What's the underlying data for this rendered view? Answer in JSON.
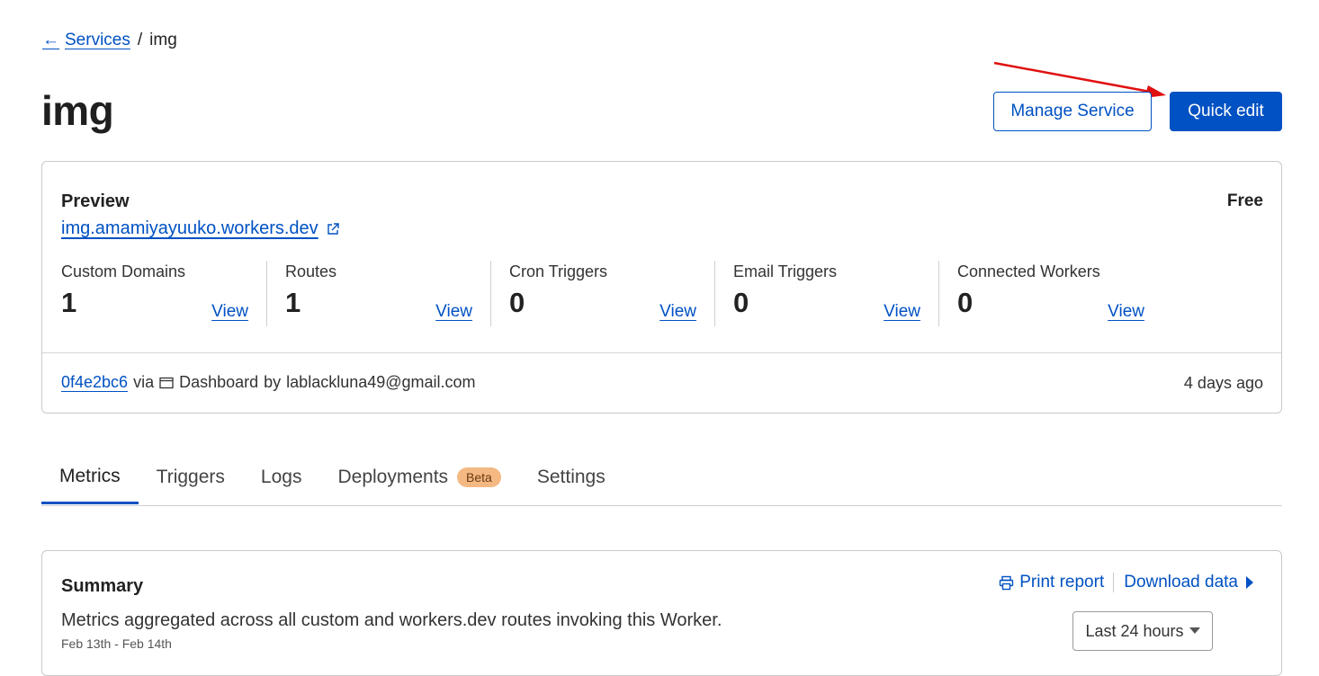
{
  "breadcrumb": {
    "back_label": "Services",
    "separator": "/",
    "current": "img"
  },
  "page": {
    "title": "img"
  },
  "actions": {
    "manage_label": "Manage Service",
    "quick_edit_label": "Quick edit"
  },
  "preview": {
    "label": "Preview",
    "plan": "Free",
    "url": "img.amamiyayuuko.workers.dev",
    "stats": [
      {
        "label": "Custom Domains",
        "value": "1",
        "view": "View"
      },
      {
        "label": "Routes",
        "value": "1",
        "view": "View"
      },
      {
        "label": "Cron Triggers",
        "value": "0",
        "view": "View"
      },
      {
        "label": "Email Triggers",
        "value": "0",
        "view": "View"
      },
      {
        "label": "Connected Workers",
        "value": "0",
        "view": "View"
      }
    ],
    "commit": {
      "hash": "0f4e2bc6",
      "via": "via",
      "source": "Dashboard",
      "by": "by",
      "author": "lablackluna49@gmail.com",
      "time": "4 days ago"
    }
  },
  "tabs": [
    {
      "label": "Metrics"
    },
    {
      "label": "Triggers"
    },
    {
      "label": "Logs"
    },
    {
      "label": "Deployments",
      "badge": "Beta"
    },
    {
      "label": "Settings"
    }
  ],
  "summary": {
    "title": "Summary",
    "description": "Metrics aggregated across all custom and workers.dev routes invoking this Worker.",
    "date_range": "Feb 13th - Feb 14th",
    "print_label": "Print report",
    "download_label": "Download data",
    "range_label": "Last 24 hours"
  },
  "colors": {
    "accent": "#0051c3",
    "badge": "#f4b983",
    "annotation_arrow": "#e01010"
  }
}
